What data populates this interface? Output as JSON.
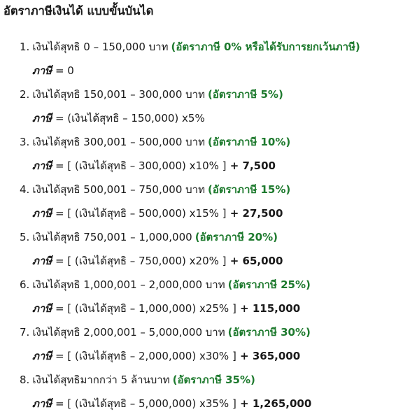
{
  "title": "อัตราภาษีเงินได้ แบบขั้นบันได",
  "colors": {
    "text": "#1a1a1a",
    "rate_green": "#1e7a2e",
    "background": "#ffffff"
  },
  "brackets": [
    {
      "number": "1.",
      "range": "เงินได้สุทธิ 0 – 150,000 บาท",
      "rate": "(อัตราภาษี 0% หรือได้รับการยกเว้นภาษี)",
      "formula_label": "ภาษี",
      "formula": " = 0",
      "formula_add": ""
    },
    {
      "number": "2.",
      "range": "เงินได้สุทธิ 150,001 – 300,000 บาท",
      "rate": "(อัตราภาษี 5%)",
      "formula_label": "ภาษี",
      "formula": " = (เงินได้สุทธิ – 150,000) x5%",
      "formula_add": ""
    },
    {
      "number": "3.",
      "range": "เงินได้สุทธิ 300,001 – 500,000 บาท",
      "rate": "(อัตราภาษี 10%)",
      "formula_label": "ภาษี",
      "formula": " = [ (เงินได้สุทธิ – 300,000) x10% ]",
      "formula_add": " + 7,500"
    },
    {
      "number": "4.",
      "range": "เงินได้สุทธิ 500,001 – 750,000 บาท",
      "rate": "(อัตราภาษี 15%)",
      "formula_label": "ภาษี",
      "formula": " = [ (เงินได้สุทธิ – 500,000) x15% ]",
      "formula_add": " + 27,500"
    },
    {
      "number": "5.",
      "range": "เงินได้สุทธิ 750,001 – 1,000,000",
      "rate": "(อัตราภาษี 20%)",
      "formula_label": "ภาษี",
      "formula": " = [ (เงินได้สุทธิ – 750,000) x20% ]",
      "formula_add": " + 65,000"
    },
    {
      "number": "6.",
      "range": "เงินได้สุทธิ 1,000,001 – 2,000,000 บาท",
      "rate": "(อัตราภาษี 25%)",
      "formula_label": "ภาษี",
      "formula": " = [ (เงินได้สุทธิ – 1,000,000) x25% ]",
      "formula_add": " + 115,000"
    },
    {
      "number": "7.",
      "range": "เงินได้สุทธิ 2,000,001 – 5,000,000 บาท",
      "rate": "(อัตราภาษี 30%)",
      "formula_label": "ภาษี",
      "formula": " = [ (เงินได้สุทธิ – 2,000,000) x30% ]",
      "formula_add": " + 365,000"
    },
    {
      "number": "8.",
      "range": "เงินได้สุทธิมากกว่า 5 ล้านบาท",
      "rate": "(อัตราภาษี 35%)",
      "formula_label": "ภาษี",
      "formula": " = [ (เงินได้สุทธิ – 5,000,000) x35% ]",
      "formula_add": " + 1,265,000"
    }
  ]
}
